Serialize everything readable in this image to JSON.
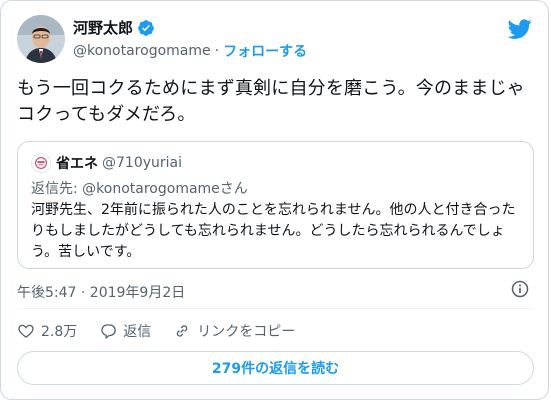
{
  "author": {
    "name": "河野太郎",
    "handle": "@konotarogomame",
    "separator": "·",
    "follow_label": "フォローする"
  },
  "tweet": {
    "text": "もう一回コクるためにまず真剣に自分を磨こう。今のままじゃコクってもダメだろ。"
  },
  "quote": {
    "name": "省エネ",
    "handle": "@710yuriai",
    "reply_to": "返信先: @konotarogomameさん",
    "text": "河野先生、2年前に振られた人のことを忘れられません。他の人と付き合ったりもしましたがどうしても忘れられません。どうしたら忘れられるんでしょう。苦しいです。"
  },
  "timestamp": "午後5:47 · 2019年9月2日",
  "actions": {
    "like_count": "2.8万",
    "reply_label": "返信",
    "copy_link_label": "リンクをコピー"
  },
  "read_replies_label": "279件の返信を読む",
  "colors": {
    "accent": "#1d9bf0",
    "secondary_text": "#536471",
    "border": "#cfd9de"
  },
  "icons": [
    "verified-badge-icon",
    "twitter-bird-icon",
    "info-icon",
    "heart-icon",
    "reply-icon",
    "link-icon"
  ]
}
